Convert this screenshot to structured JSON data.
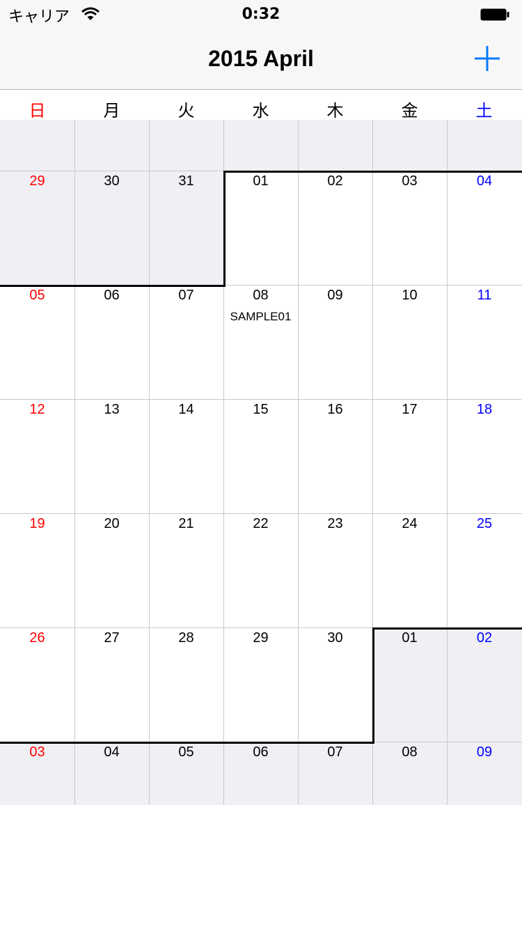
{
  "status_bar": {
    "carrier": "キャリア",
    "time": "0:32"
  },
  "nav": {
    "title": "2015 April",
    "add_icon": "plus-icon"
  },
  "colors": {
    "sunday": "#ff0000",
    "saturday": "#0000ff",
    "accent": "#007aff",
    "other_month_bg": "#efeff4"
  },
  "weekdays": [
    "日",
    "月",
    "火",
    "水",
    "木",
    "金",
    "土"
  ],
  "calendar": {
    "weeks": [
      [
        {
          "day": "",
          "other": true
        },
        {
          "day": "",
          "other": true
        },
        {
          "day": "",
          "other": true
        },
        {
          "day": "",
          "other": true
        },
        {
          "day": "",
          "other": true
        },
        {
          "day": "",
          "other": true
        },
        {
          "day": "",
          "other": true
        }
      ],
      [
        {
          "day": "29",
          "other": true
        },
        {
          "day": "30",
          "other": true
        },
        {
          "day": "31",
          "other": true
        },
        {
          "day": "01"
        },
        {
          "day": "02"
        },
        {
          "day": "03"
        },
        {
          "day": "04"
        }
      ],
      [
        {
          "day": "05"
        },
        {
          "day": "06"
        },
        {
          "day": "07"
        },
        {
          "day": "08",
          "event": "SAMPLE01"
        },
        {
          "day": "09"
        },
        {
          "day": "10"
        },
        {
          "day": "11"
        }
      ],
      [
        {
          "day": "12"
        },
        {
          "day": "13"
        },
        {
          "day": "14"
        },
        {
          "day": "15"
        },
        {
          "day": "16"
        },
        {
          "day": "17"
        },
        {
          "day": "18"
        }
      ],
      [
        {
          "day": "19"
        },
        {
          "day": "20"
        },
        {
          "day": "21"
        },
        {
          "day": "22"
        },
        {
          "day": "23"
        },
        {
          "day": "24"
        },
        {
          "day": "25"
        }
      ],
      [
        {
          "day": "26"
        },
        {
          "day": "27"
        },
        {
          "day": "28"
        },
        {
          "day": "29"
        },
        {
          "day": "30"
        },
        {
          "day": "01",
          "other": true
        },
        {
          "day": "02",
          "other": true
        }
      ],
      [
        {
          "day": "03",
          "other": true
        },
        {
          "day": "04",
          "other": true
        },
        {
          "day": "05",
          "other": true
        },
        {
          "day": "06",
          "other": true
        },
        {
          "day": "07",
          "other": true
        },
        {
          "day": "08",
          "other": true
        },
        {
          "day": "09",
          "other": true
        }
      ]
    ]
  }
}
